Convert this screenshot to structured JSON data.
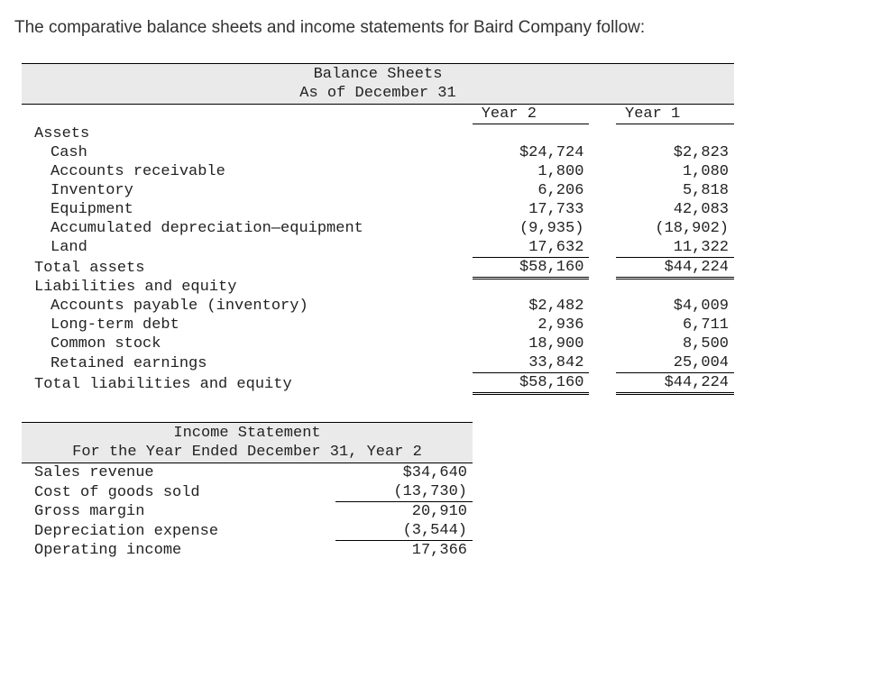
{
  "intro": "The comparative balance sheets and income statements for Baird Company follow:",
  "bs": {
    "title": "Balance Sheets",
    "subtitle": "As of December 31",
    "col_y2": "Year 2",
    "col_y1": "Year 1",
    "section_assets": "Assets",
    "rows_assets": [
      {
        "label": "Cash",
        "y2": "$24,724",
        "y1": "$2,823"
      },
      {
        "label": "Accounts receivable",
        "y2": "1,800",
        "y1": "1,080"
      },
      {
        "label": "Inventory",
        "y2": "6,206",
        "y1": "5,818"
      },
      {
        "label": "Equipment",
        "y2": "17,733",
        "y1": "42,083"
      },
      {
        "label": "Accumulated depreciation—equipment",
        "y2": "(9,935)",
        "y1": "(18,902)"
      },
      {
        "label": "Land",
        "y2": "17,632",
        "y1": "11,322"
      }
    ],
    "total_assets": {
      "label": "Total assets",
      "y2": "$58,160",
      "y1": "$44,224"
    },
    "section_liab": "Liabilities and equity",
    "rows_liab": [
      {
        "label": "Accounts payable (inventory)",
        "y2": "$2,482",
        "y1": "$4,009"
      },
      {
        "label": "Long-term debt",
        "y2": "2,936",
        "y1": "6,711"
      },
      {
        "label": "Common stock",
        "y2": "18,900",
        "y1": "8,500"
      },
      {
        "label": "Retained earnings",
        "y2": "33,842",
        "y1": "25,004"
      }
    ],
    "total_liab": {
      "label": "Total liabilities and equity",
      "y2": "$58,160",
      "y1": "$44,224"
    }
  },
  "is": {
    "title": "Income Statement",
    "subtitle": "For the Year Ended December 31, Year 2",
    "rows": [
      {
        "label": "Sales revenue",
        "val": "$34,640",
        "border": ""
      },
      {
        "label": "Cost of goods sold",
        "val": "(13,730)",
        "border": ""
      },
      {
        "label": "Gross margin",
        "val": "20,910",
        "border": "top"
      },
      {
        "label": "Depreciation expense",
        "val": "(3,544)",
        "border": ""
      },
      {
        "label": "Operating income",
        "val": "17,366",
        "border": "top"
      }
    ]
  },
  "chart_data": {
    "type": "table",
    "title": "Baird Company — Comparative Balance Sheets and Income Statement",
    "balance_sheets": {
      "as_of": "December 31",
      "columns": [
        "Year 2",
        "Year 1"
      ],
      "assets": {
        "Cash": [
          24724,
          2823
        ],
        "Accounts receivable": [
          1800,
          1080
        ],
        "Inventory": [
          6206,
          5818
        ],
        "Equipment": [
          17733,
          42083
        ],
        "Accumulated depreciation—equipment": [
          -9935,
          -18902
        ],
        "Land": [
          17632,
          11322
        ],
        "Total assets": [
          58160,
          44224
        ]
      },
      "liabilities_and_equity": {
        "Accounts payable (inventory)": [
          2482,
          4009
        ],
        "Long-term debt": [
          2936,
          6711
        ],
        "Common stock": [
          18900,
          8500
        ],
        "Retained earnings": [
          33842,
          25004
        ],
        "Total liabilities and equity": [
          58160,
          44224
        ]
      }
    },
    "income_statement": {
      "period": "Year Ended December 31, Year 2",
      "Sales revenue": 34640,
      "Cost of goods sold": -13730,
      "Gross margin": 20910,
      "Depreciation expense": -3544,
      "Operating income": 17366
    }
  }
}
